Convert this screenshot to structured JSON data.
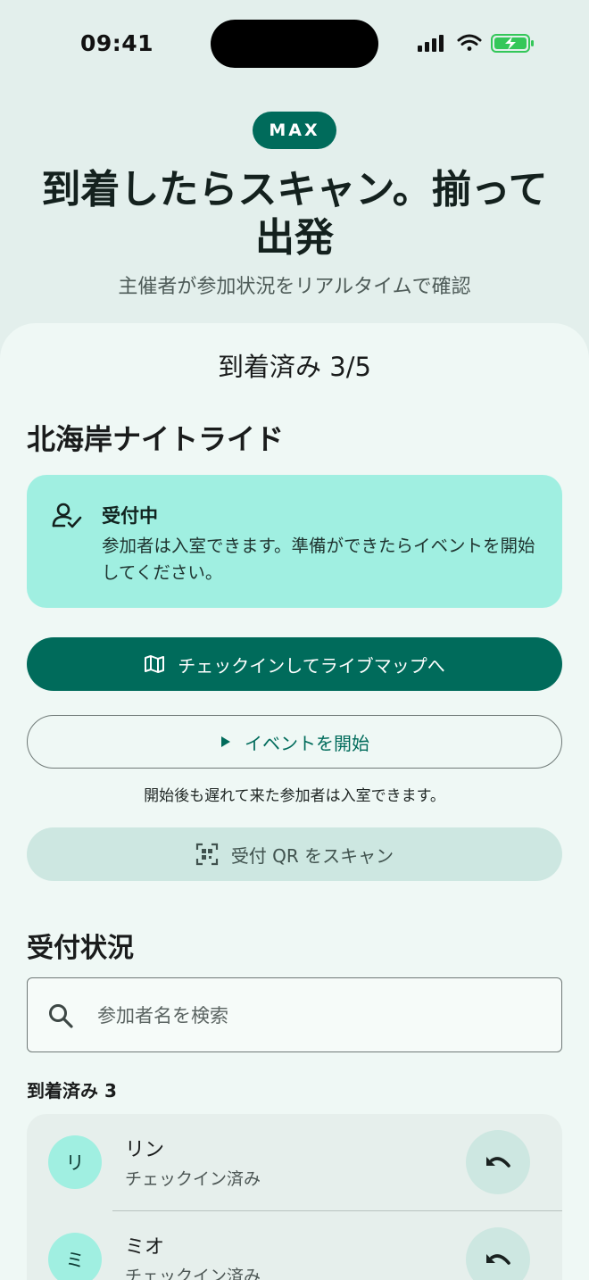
{
  "status_bar": {
    "time": "09:41"
  },
  "hero": {
    "badge": "MAX",
    "title": "到着したらスキャン。揃って出発",
    "subtitle": "主催者が参加状況をリアルタイムで確認"
  },
  "sheet": {
    "header": "到着済み 3/5",
    "event_title": "北海岸ナイトライド",
    "status_card": {
      "icon": "person-check-icon",
      "label": "受付中",
      "description": "参加者は入室できます。準備ができたらイベントを開始してください。"
    },
    "primary_button": {
      "icon": "map-icon",
      "label": "チェックインしてライブマップへ"
    },
    "outline_button": {
      "icon": "play-icon",
      "label": "イベントを開始"
    },
    "hint": "開始後も遅れて来た参加者は入室できます。",
    "tonal_button": {
      "icon": "qr-scan-icon",
      "label": "受付 QR をスキャン"
    }
  },
  "attendance": {
    "section_title": "受付状況",
    "search_placeholder": "参加者名を検索",
    "arrived_label": "到着済み 3",
    "participants": [
      {
        "initial": "リ",
        "name": "リン",
        "status": "チェックイン済み"
      },
      {
        "initial": "ミ",
        "name": "ミオ",
        "status": "チェックイン済み"
      }
    ]
  },
  "colors": {
    "primary": "#006b5b",
    "status_card": "#a0efe1",
    "tonal": "#cde7e1",
    "background": "#e3efec"
  }
}
